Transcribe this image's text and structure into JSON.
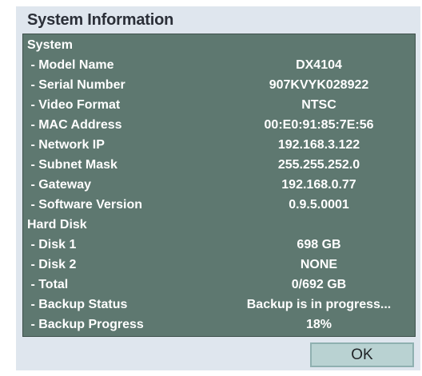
{
  "dialog": {
    "title": "System Information",
    "ok_label": "OK"
  },
  "rows": [
    {
      "label": "System",
      "value": ""
    },
    {
      "label": " - Model Name",
      "value": "DX4104"
    },
    {
      "label": " - Serial Number",
      "value": "907KVYK028922"
    },
    {
      "label": " - Video Format",
      "value": "NTSC"
    },
    {
      "label": " - MAC Address",
      "value": "00:E0:91:85:7E:56"
    },
    {
      "label": " - Network IP",
      "value": "192.168.3.122"
    },
    {
      "label": " - Subnet Mask",
      "value": "255.255.252.0"
    },
    {
      "label": " - Gateway",
      "value": "192.168.0.77"
    },
    {
      "label": " - Software Version",
      "value": "0.9.5.0001"
    },
    {
      "label": "Hard Disk",
      "value": ""
    },
    {
      "label": " - Disk 1",
      "value": "698 GB"
    },
    {
      "label": " - Disk 2",
      "value": "NONE"
    },
    {
      "label": " - Total",
      "value": "0/692 GB"
    },
    {
      "label": " - Backup Status",
      "value": "Backup is in progress..."
    },
    {
      "label": " - Backup Progress",
      "value": "18%"
    }
  ]
}
